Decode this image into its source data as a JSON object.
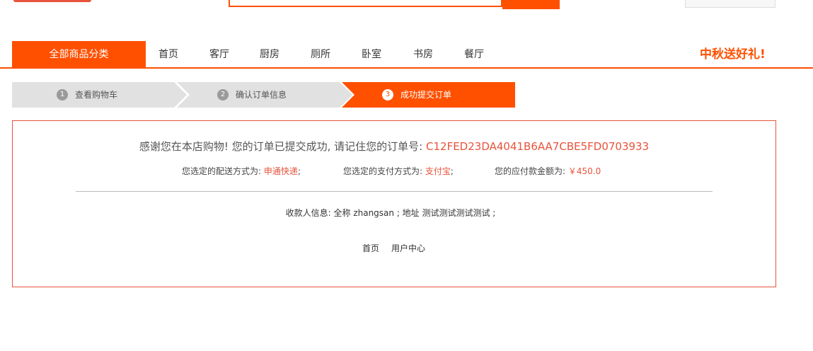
{
  "header": {
    "search_button_label": ""
  },
  "nav": {
    "all_categories": "全部商品分类",
    "items": [
      "首页",
      "客厅",
      "厨房",
      "厕所",
      "卧室",
      "书房",
      "餐厅"
    ],
    "promo": "中秋送好礼!"
  },
  "steps": [
    {
      "num": "1",
      "label": "查看购物车",
      "active": false
    },
    {
      "num": "2",
      "label": "确认订单信息",
      "active": false
    },
    {
      "num": "3",
      "label": "成功提交订单",
      "active": true
    }
  ],
  "order": {
    "thanks_text": "感谢您在本店购物! 您的订单已提交成功, 请记住您的订单号: ",
    "order_number": "C12FED23DA4041B6AA7CBE5FD0703933",
    "shipping_label": "您选定的配送方式为:",
    "shipping_value": "申通快递",
    "payment_label": "您选定的支付方式为:",
    "payment_value": "支付宝",
    "amount_label": "您的应付款金额为:",
    "amount_value": "￥450.0",
    "sep": ";",
    "receiver_text": "收款人信息: 全称 zhangsan ; 地址 测试测试测试测试 ;"
  },
  "links": {
    "home": "首页",
    "user_center": "用户中心"
  },
  "colors": {
    "accent": "#ff5000",
    "step_inactive": "#e1e1e1"
  }
}
